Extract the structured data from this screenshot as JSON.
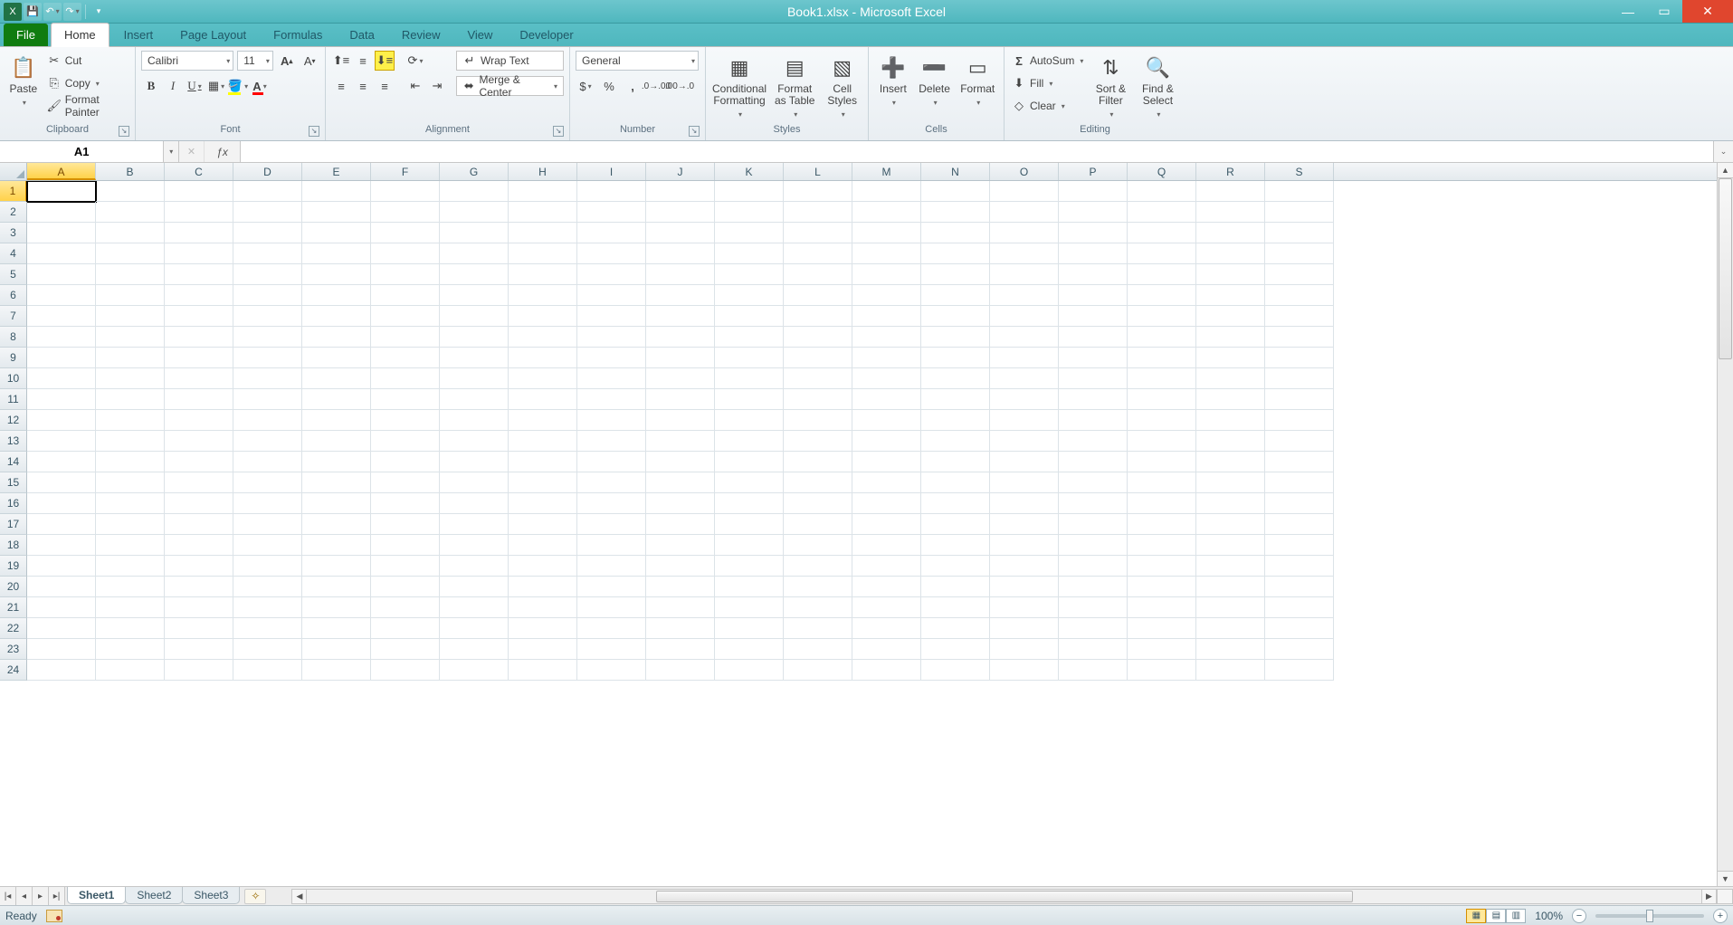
{
  "title": "Book1.xlsx - Microsoft Excel",
  "qat": {
    "save": "💾",
    "undo": "↶",
    "redo": "↷"
  },
  "tabs": {
    "file": "File",
    "items": [
      "Home",
      "Insert",
      "Page Layout",
      "Formulas",
      "Data",
      "Review",
      "View",
      "Developer"
    ],
    "active": "Home"
  },
  "ribbon": {
    "clipboard": {
      "label": "Clipboard",
      "paste": "Paste",
      "cut": "Cut",
      "copy": "Copy",
      "formatPainter": "Format Painter"
    },
    "font": {
      "label": "Font",
      "name": "Calibri",
      "size": "11"
    },
    "alignment": {
      "label": "Alignment",
      "wrap": "Wrap Text",
      "merge": "Merge & Center"
    },
    "number": {
      "label": "Number",
      "format": "General"
    },
    "styles": {
      "label": "Styles",
      "cond": "Conditional Formatting",
      "table": "Format as Table",
      "cell": "Cell Styles"
    },
    "cells": {
      "label": "Cells",
      "insert": "Insert",
      "delete": "Delete",
      "format": "Format"
    },
    "editing": {
      "label": "Editing",
      "autosum": "AutoSum",
      "fill": "Fill",
      "clear": "Clear",
      "sort": "Sort & Filter",
      "find": "Find & Select"
    }
  },
  "namebox": "A1",
  "formula": "",
  "columns": [
    "A",
    "B",
    "C",
    "D",
    "E",
    "F",
    "G",
    "H",
    "I",
    "J",
    "K",
    "L",
    "M",
    "N",
    "O",
    "P",
    "Q",
    "R",
    "S"
  ],
  "rows": 24,
  "activeCell": {
    "col": 0,
    "row": 0
  },
  "sheets": {
    "items": [
      "Sheet1",
      "Sheet2",
      "Sheet3"
    ],
    "active": "Sheet1"
  },
  "status": {
    "ready": "Ready",
    "zoom": "100%"
  }
}
